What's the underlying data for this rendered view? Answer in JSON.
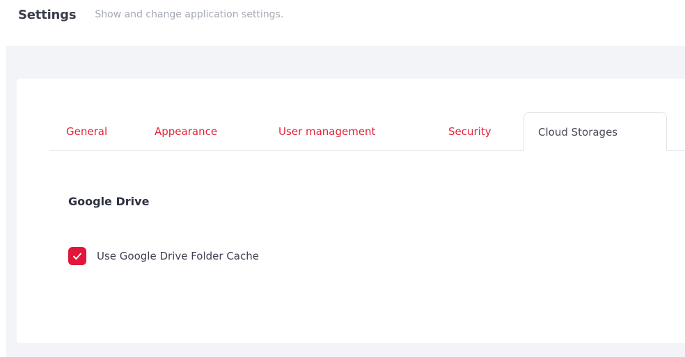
{
  "header": {
    "title": "Settings",
    "subtitle": "Show and change application settings."
  },
  "tabs": [
    {
      "label": "General",
      "active": false
    },
    {
      "label": "Appearance",
      "active": false
    },
    {
      "label": "User management",
      "active": false
    },
    {
      "label": "Security",
      "active": false
    },
    {
      "label": "Cloud Storages",
      "active": true
    }
  ],
  "section": {
    "title": "Google Drive",
    "checkbox": {
      "label": "Use Google Drive Folder Cache",
      "checked": true
    }
  },
  "colors": {
    "accent": "#e0163a",
    "tab_link": "#e1243a",
    "page_background": "#f3f4f7",
    "card_background": "#ffffff"
  },
  "icons": {
    "checkbox_check": "check-icon"
  }
}
